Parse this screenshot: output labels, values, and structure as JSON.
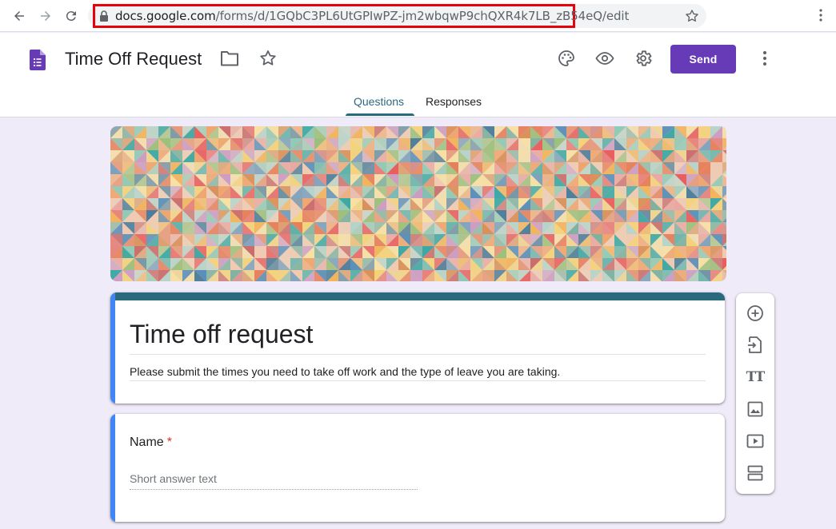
{
  "browser": {
    "url_host": "docs.google.com",
    "url_path": "/forms/d/1GQbC3PL6UtGPIwPZ-jm2wbqwP9chQXR4k7LB_zB54eQ/edit"
  },
  "header": {
    "doc_title": "Time Off Request",
    "send_label": "Send",
    "tabs": [
      {
        "label": "Questions",
        "active": true
      },
      {
        "label": "Responses",
        "active": false
      }
    ]
  },
  "form": {
    "title": "Time off request",
    "description": "Please submit the times you need to take off work and the type of leave you are taking.",
    "questions": [
      {
        "label": "Name",
        "required_mark": "*",
        "placeholder": "Short answer text"
      }
    ]
  },
  "theme": {
    "accent": "#2b6a7e",
    "send_button": "#673ab7",
    "background": "#f0ebf8",
    "focus_bar": "#4285f4",
    "highlight_box": "#e8000b"
  },
  "toolbar": {
    "items": [
      "add-question-icon",
      "import-questions-icon",
      "add-title-icon",
      "add-image-icon",
      "add-video-icon",
      "add-section-icon"
    ]
  }
}
